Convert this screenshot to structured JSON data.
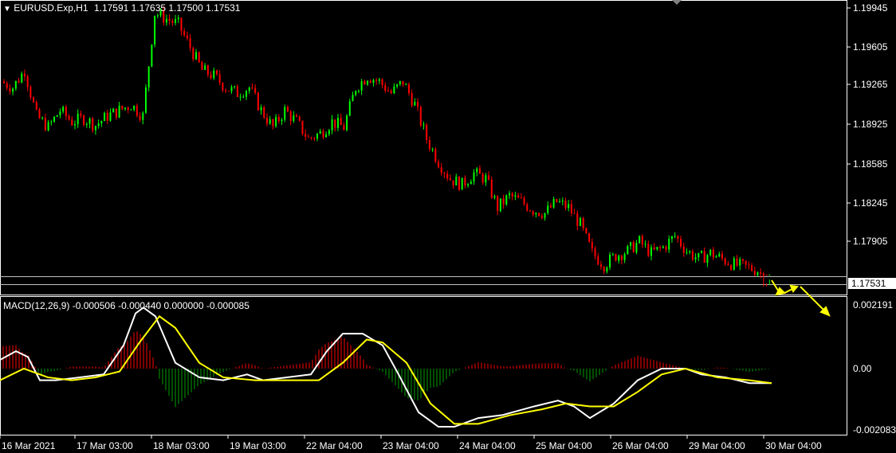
{
  "symbol_header": {
    "symbol": "EURUSD.Exp,H1",
    "ohlc": "1.17591 1.17635 1.17500 1.17531"
  },
  "price_axis": {
    "labels": [
      "1.19945",
      "1.19605",
      "1.19265",
      "1.18925",
      "1.18585",
      "1.18245",
      "1.17905"
    ],
    "current_price": "1.17531"
  },
  "indicator": {
    "title": "MACD(12,26,9) -0.000506 -0.000440 0.000000 -0.000085",
    "axis_labels": [
      "0.002191",
      "0.00",
      "-0.002083"
    ]
  },
  "time_axis": {
    "labels": [
      "16 Mar 2021",
      "17 Mar 03:00",
      "18 Mar 03:00",
      "19 Mar 03:00",
      "22 Mar 04:00",
      "23 Mar 04:00",
      "24 Mar 04:00",
      "25 Mar 04:00",
      "26 Mar 04:00",
      "29 Mar 04:00",
      "30 Mar 04:00"
    ]
  },
  "colors": {
    "background": "#000000",
    "bull_candle": "#00ff00",
    "bear_candle": "#ff0000",
    "grid_frame": "#ffffff",
    "macd_main": "#ffffff",
    "macd_signal": "#ffff00",
    "histogram_pos": "#ff0000",
    "histogram_neg": "#00a000",
    "arrows": "#ffff00"
  },
  "chart_data": {
    "type": "candlestick",
    "price_range": [
      1.17531,
      1.19945
    ],
    "price_series_close": [
      1.193,
      1.1925,
      1.194,
      1.19,
      1.189,
      1.1905,
      1.1895,
      1.1898,
      1.1892,
      1.19,
      1.1905,
      1.191,
      1.19,
      1.199,
      1.1985,
      1.198,
      1.196,
      1.194,
      1.1935,
      1.1925,
      1.192,
      1.1925,
      1.1905,
      1.189,
      1.1905,
      1.1895,
      1.188,
      1.1885,
      1.1895,
      1.189,
      1.1925,
      1.1935,
      1.193,
      1.192,
      1.193,
      1.191,
      1.188,
      1.186,
      1.1845,
      1.184,
      1.185,
      1.1845,
      1.182,
      1.183,
      1.1825,
      1.1818,
      1.1815,
      1.1825,
      1.182,
      1.1805,
      1.178,
      1.177,
      1.1778,
      1.1782,
      1.179,
      1.178,
      1.1785,
      1.1795,
      1.1782,
      1.1775,
      1.178,
      1.1775,
      1.177,
      1.1768,
      1.1765,
      1.1753
    ],
    "macd_range": [
      -0.002083,
      0.002191
    ]
  }
}
